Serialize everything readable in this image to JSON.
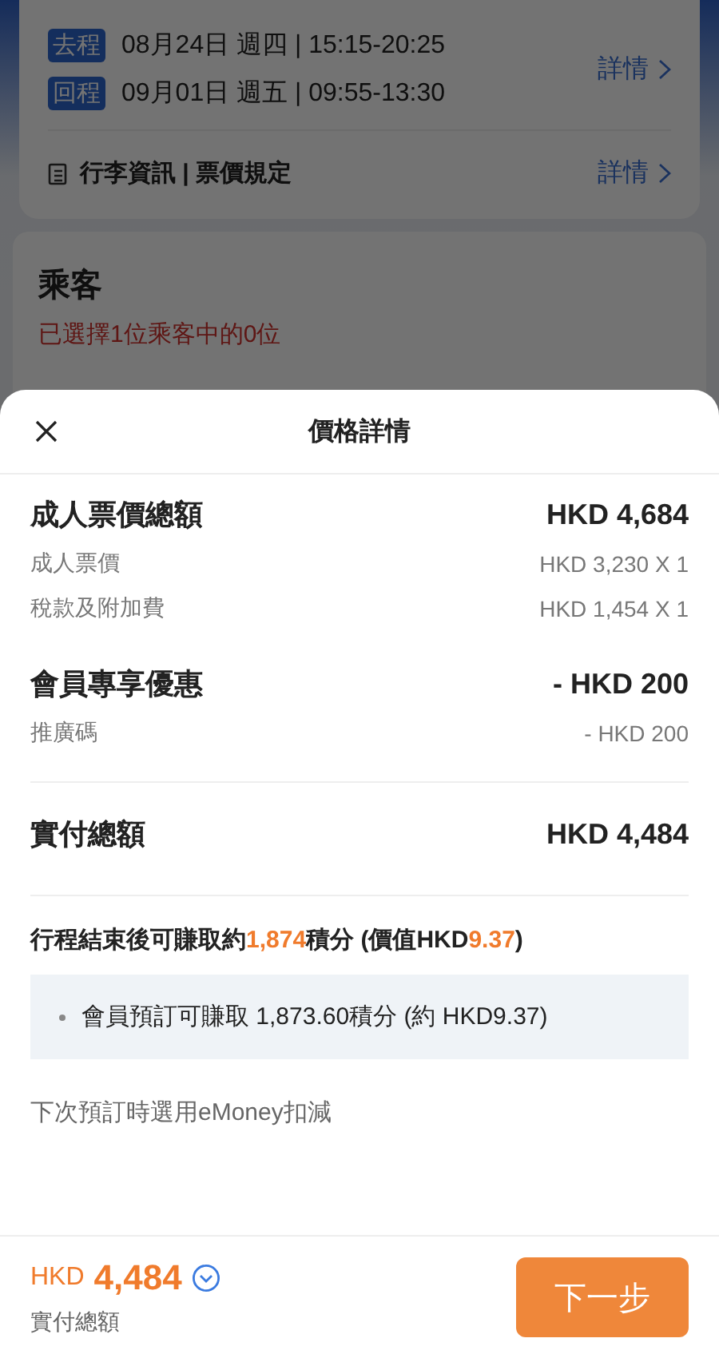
{
  "background": {
    "flights": [
      {
        "tag": "去程",
        "text": "08月24日 週四 | 15:15-20:25"
      },
      {
        "tag": "回程",
        "text": "09月01日 週五 | 09:55-13:30"
      }
    ],
    "flight_details_link": "詳情",
    "baggage_label": "行李資訊 | 票價規定",
    "baggage_details_link": "詳情",
    "passengers": {
      "title": "乘客",
      "status": "已選擇1位乘客中的0位"
    }
  },
  "sheet": {
    "title": "價格詳情",
    "groups": [
      {
        "label": "成人票價總額",
        "amount": "HKD 4,684",
        "items": [
          {
            "label": "成人票價",
            "amount": "HKD 3,230 X 1"
          },
          {
            "label": "稅款及附加費",
            "amount": "HKD 1,454 X 1"
          }
        ]
      },
      {
        "label": "會員專享優惠",
        "amount": "- HKD 200",
        "items": [
          {
            "label": "推廣碼",
            "amount": "- HKD 200"
          }
        ]
      }
    ],
    "total": {
      "label": "實付總額",
      "amount": "HKD 4,484"
    },
    "points_note": [
      {
        "text": "行程結束後可賺取約",
        "highlight": false
      },
      {
        "text": "1,874",
        "highlight": true
      },
      {
        "text": "積分 (價值HKD",
        "highlight": false
      },
      {
        "text": "9.37",
        "highlight": true
      },
      {
        "text": ")",
        "highlight": false
      }
    ],
    "points_bullets": [
      "會員預訂可賺取 1,873.60積分 (約 HKD9.37)"
    ],
    "emoney_note": "下次預訂時選用eMoney扣減"
  },
  "footer": {
    "currency": "HKD",
    "amount": "4,484",
    "label": "實付總額",
    "next_button": "下一步"
  }
}
